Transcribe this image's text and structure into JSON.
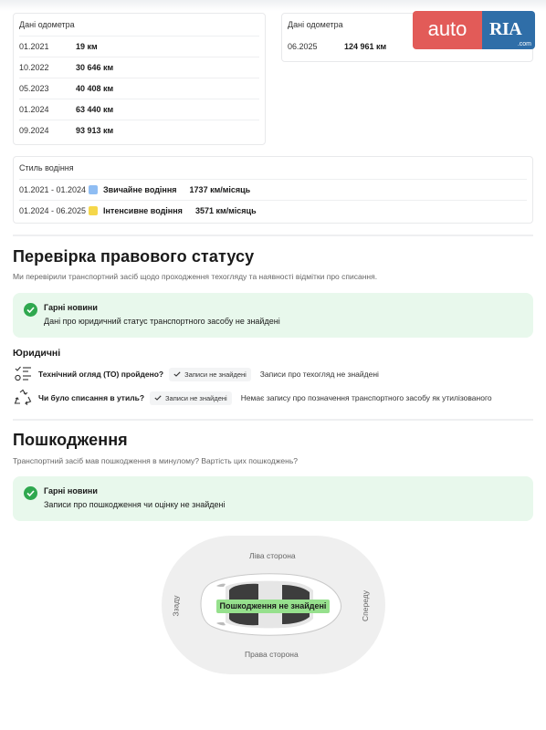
{
  "logo": {
    "auto": "auto",
    "ria": "RIA",
    "com": ".com"
  },
  "odometer_left": {
    "header": "Дані одометра",
    "rows": [
      {
        "date": "01.2021",
        "km": "19 км"
      },
      {
        "date": "10.2022",
        "km": "30 646 км"
      },
      {
        "date": "05.2023",
        "km": "40 408 км"
      },
      {
        "date": "01.2024",
        "km": "63 440 км"
      },
      {
        "date": "09.2024",
        "km": "93 913 км"
      }
    ]
  },
  "odometer_right": {
    "header": "Дані одометра",
    "rows": [
      {
        "date": "06.2025",
        "km": "124 961 км"
      }
    ]
  },
  "driving_style": {
    "header": "Стиль водіння",
    "rows": [
      {
        "period": "01.2021 - 01.2024",
        "color": "#8fbdf3",
        "style": "Звичайне водіння",
        "rate": "1737 км/місяць"
      },
      {
        "period": "01.2024 - 06.2025",
        "color": "#f5d74a",
        "style": "Інтенсивне водіння",
        "rate": "3571 км/місяць"
      }
    ]
  },
  "legal": {
    "title": "Перевірка правового статусу",
    "subtitle": "Ми перевірили транспортний засіб щодо проходження техогляду та наявності відмітки про списання.",
    "good_title": "Гарні новини",
    "good_text": "Дані про юридичний статус транспортного засобу не знайдені",
    "section": "Юридичні",
    "items": [
      {
        "icon": "checklist-icon",
        "question": "Технічний огляд (ТО) пройдено?",
        "chip": "Записи не знайдені",
        "answer": "Записи про техогляд не знайдені"
      },
      {
        "icon": "recycle-icon",
        "question": "Чи було списання в утиль?",
        "chip": "Записи не знайдені",
        "answer": "Немає запису про позначення транспортного засобу як утилізованого"
      }
    ]
  },
  "damage": {
    "title": "Пошкодження",
    "subtitle": "Транспортний засіб мав пошкодження в минулому? Вартість цих пошкоджень?",
    "good_title": "Гарні новини",
    "good_text": "Записи про пошкодження чи оцінку не знайдені",
    "sides": {
      "left": "Ліва сторона",
      "right": "Права сторона",
      "front": "Спереду",
      "rear": "Ззаду"
    },
    "badge": "Пошкодження не знайдені"
  },
  "colors": {
    "good_bg": "#e8f8ec",
    "check_green": "#2fa84f",
    "badge_green": "#96e08d",
    "auto_red": "#e25b58",
    "ria_blue": "#2f6ea8"
  }
}
